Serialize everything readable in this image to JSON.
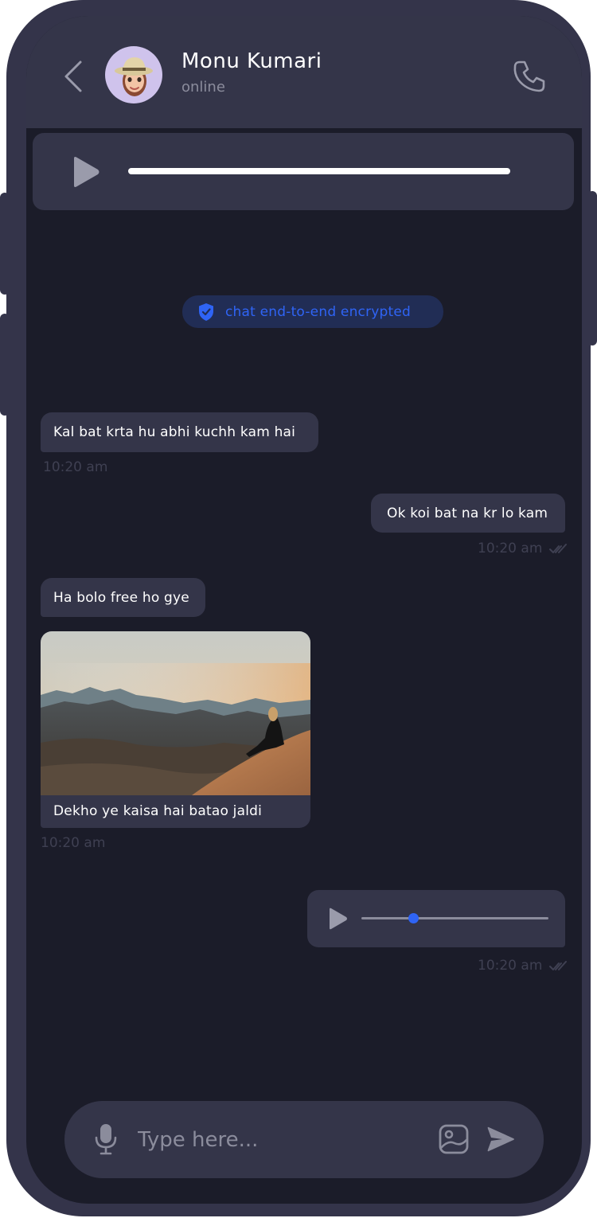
{
  "contact": {
    "name": "Monu Kumari",
    "status": "online"
  },
  "top_audio": {
    "progress": 0
  },
  "encryption_notice": "chat end-to-end encrypted",
  "messages": [
    {
      "direction": "incoming",
      "type": "text",
      "text": "Kal bat krta hu abhi kuchh kam hai",
      "time": "10:20 am"
    },
    {
      "direction": "outgoing",
      "type": "text",
      "text": "Ok koi bat na kr lo kam",
      "time": "10:20 am",
      "status": "read"
    },
    {
      "direction": "incoming",
      "type": "text",
      "text": "Ha bolo free ho gye"
    },
    {
      "direction": "incoming",
      "type": "image",
      "caption": "Dekho ye kaisa hai batao jaldi",
      "time": "10:20 am"
    },
    {
      "direction": "outgoing",
      "type": "voice",
      "progress": 0.28,
      "time": "10:20 am",
      "status": "read"
    }
  ],
  "composer": {
    "placeholder": "Type here..."
  },
  "icons": {
    "back": "chevron-left-icon",
    "call": "phone-icon",
    "play": "play-icon",
    "shield": "shield-check-icon",
    "ticks": "double-check-icon",
    "mic": "microphone-icon",
    "gallery": "image-icon",
    "send": "send-icon"
  },
  "colors": {
    "background": "#1b1c29",
    "surface": "#343549",
    "accent": "#2f64f5",
    "muted_text": "#8b8c9c",
    "timestamp": "#3f4052"
  }
}
